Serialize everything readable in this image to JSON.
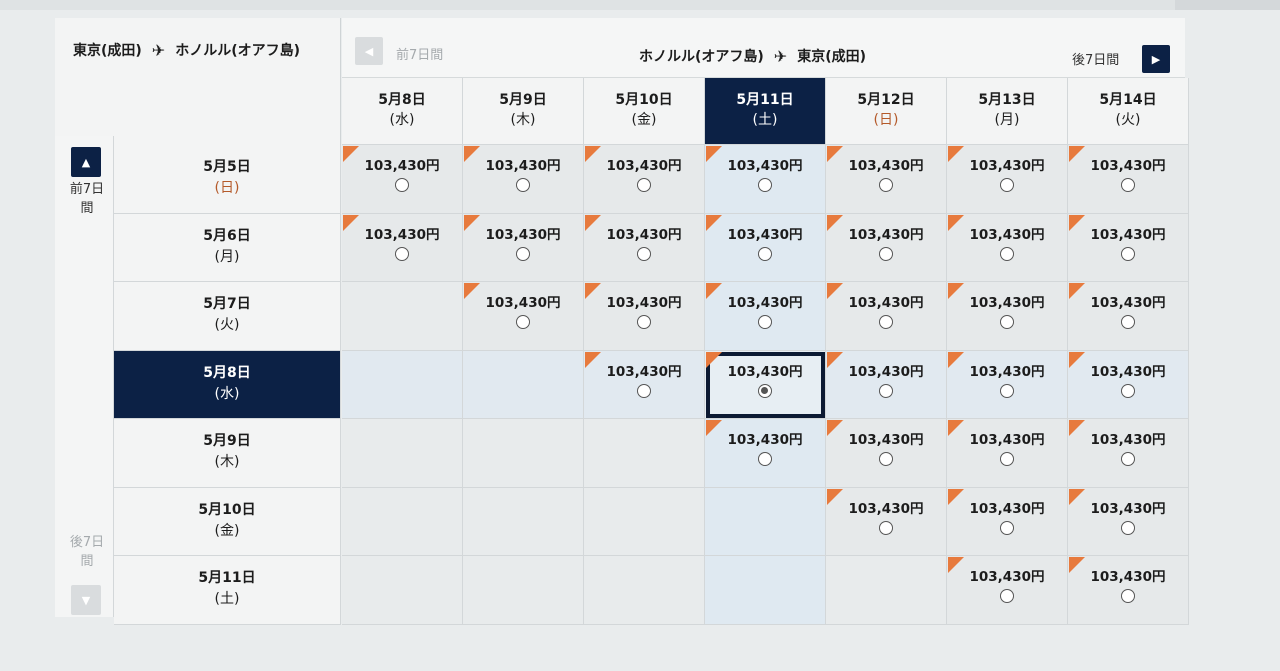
{
  "outbound": {
    "from": "東京(成田)",
    "to": "ホノルル(オアフ島)",
    "plane_icon": "airplane-icon"
  },
  "inbound": {
    "from": "ホノルル(オアフ島)",
    "to": "東京(成田)",
    "plane_icon": "airplane-icon"
  },
  "nav": {
    "prev_week": "前7日間",
    "next_week": "後7日間",
    "prev_rows_top": "前7日",
    "prev_rows_bottom": "間",
    "next_rows_top": "後7日",
    "next_rows_bottom": "間"
  },
  "columns": [
    {
      "date": "5月8日",
      "dow": "(水)"
    },
    {
      "date": "5月9日",
      "dow": "(木)"
    },
    {
      "date": "5月10日",
      "dow": "(金)"
    },
    {
      "date": "5月11日",
      "dow": "(土)"
    },
    {
      "date": "5月12日",
      "dow": "(日)"
    },
    {
      "date": "5月13日",
      "dow": "(月)"
    },
    {
      "date": "5月14日",
      "dow": "(火)"
    }
  ],
  "rows": [
    {
      "date": "5月5日",
      "dow": "(日)"
    },
    {
      "date": "5月6日",
      "dow": "(月)"
    },
    {
      "date": "5月7日",
      "dow": "(火)"
    },
    {
      "date": "5月8日",
      "dow": "(水)"
    },
    {
      "date": "5月9日",
      "dow": "(木)"
    },
    {
      "date": "5月10日",
      "dow": "(金)"
    },
    {
      "date": "5月11日",
      "dow": "(土)"
    }
  ],
  "selected": {
    "row": 3,
    "col": 3
  },
  "colors": {
    "navy": "#0c2145",
    "accent_orange": "#e77a3d",
    "sunday_red": "#b45a2a"
  },
  "price": "103,430円",
  "grid": [
    [
      "103,430円",
      "103,430円",
      "103,430円",
      "103,430円",
      "103,430円",
      "103,430円",
      "103,430円"
    ],
    [
      "103,430円",
      "103,430円",
      "103,430円",
      "103,430円",
      "103,430円",
      "103,430円",
      "103,430円"
    ],
    [
      "",
      "103,430円",
      "103,430円",
      "103,430円",
      "103,430円",
      "103,430円",
      "103,430円"
    ],
    [
      "",
      "",
      "103,430円",
      "103,430円",
      "103,430円",
      "103,430円",
      "103,430円"
    ],
    [
      "",
      "",
      "",
      "103,430円",
      "103,430円",
      "103,430円",
      "103,430円"
    ],
    [
      "",
      "",
      "",
      "",
      "103,430円",
      "103,430円",
      "103,430円"
    ],
    [
      "",
      "",
      "",
      "",
      "",
      "103,430円",
      "103,430円"
    ]
  ]
}
